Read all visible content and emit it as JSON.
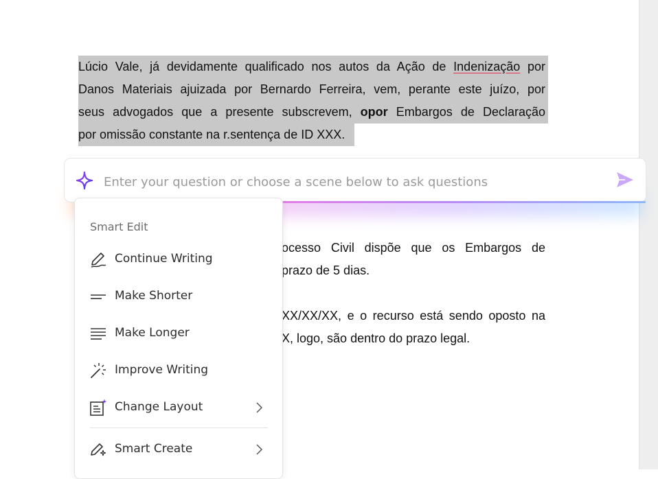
{
  "document": {
    "selected_paragraph": {
      "line1_before": "Lúcio Vale, já devidamente qualificado nos autos da Ação de ",
      "line1_underlined": "Indenização",
      "line1_after": " por",
      "line2": "Danos Materiais ajuizada por Bernardo Ferreira, vem, perante este juízo, por",
      "line3_before": "seus advogados que a presente subscrevem, ",
      "line3_bold": "opor",
      "line3_after": " Embargos de Declaração",
      "line4": "por omissão constante na r.sentença de ID XXX."
    },
    "partial_lines": {
      "line1": "ocesso Civil dispõe que os Embargos de",
      "line2": "prazo de 5 dias.",
      "line3": "XX/XX/XX, e o recurso está sendo oposto na",
      "line4": "X, logo, são dentro do prazo legal."
    }
  },
  "ask_bar": {
    "placeholder": "Enter your question or choose a scene below to ask questions",
    "value": ""
  },
  "menu": {
    "heading": "Smart Edit",
    "items": [
      {
        "label": "Continue Writing",
        "icon": "pen-icon"
      },
      {
        "label": "Make Shorter",
        "icon": "short-lines-icon"
      },
      {
        "label": "Make Longer",
        "icon": "long-lines-icon"
      },
      {
        "label": "Improve Writing",
        "icon": "magic-wand-icon"
      },
      {
        "label": "Change Layout",
        "icon": "layout-sparkle-icon",
        "submenu": true
      },
      {
        "label": "Smart Create",
        "icon": "pen-sparkle-icon",
        "submenu": true
      }
    ]
  },
  "colors": {
    "accent_purple": "#7b3fe4",
    "send_lavender": "#c9a8f7",
    "selection_gray": "#c8c8c8",
    "spell_underline": "#e0334b"
  }
}
